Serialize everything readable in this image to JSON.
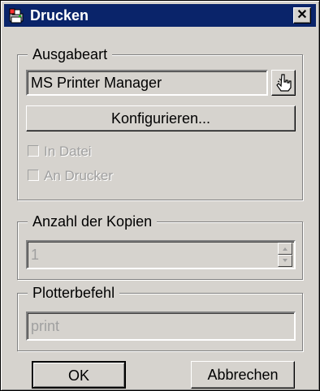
{
  "window": {
    "title": "Drucken",
    "close_glyph": "✕",
    "titlebar_color": "#0a246a",
    "face_color": "#d6d3ce"
  },
  "output_group": {
    "legend": "Ausgabeart",
    "printer_value": "MS Printer Manager",
    "browse_icon": "pointing-hand-icon",
    "configure_label": "Konfigurieren...",
    "checkboxes": [
      {
        "label": "In Datei",
        "checked": false,
        "disabled": true
      },
      {
        "label": "An Drucker",
        "checked": false,
        "disabled": true
      }
    ]
  },
  "copies_group": {
    "legend": "Anzahl der Kopien",
    "value": "1"
  },
  "plotter_group": {
    "legend": "Plotterbefehl",
    "value": "print"
  },
  "buttons": {
    "ok_label": "OK",
    "cancel_label": "Abbrechen"
  }
}
